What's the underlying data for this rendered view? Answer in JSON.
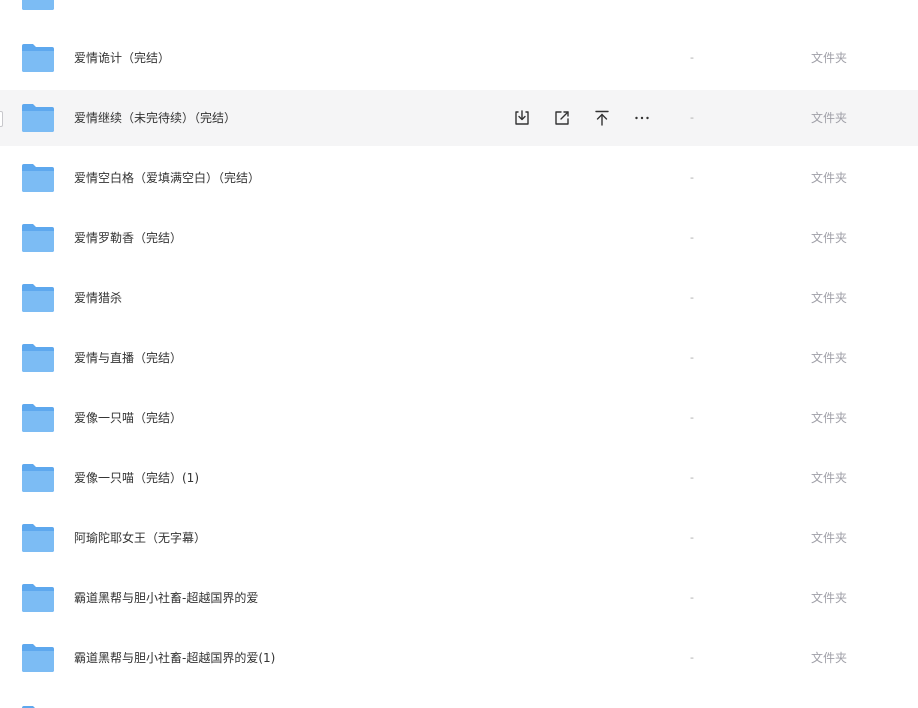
{
  "partial_top": {
    "text": "."
  },
  "hover_actions": {
    "download_icon": "download-icon",
    "share_icon": "share-icon",
    "pin_top_icon": "pin-to-top-icon",
    "more_icon": "more-icon"
  },
  "rows": [
    {
      "name": "爱情诡计（完结）",
      "size": "-",
      "type": "文件夹"
    },
    {
      "name": "爱情继续（未完待续）（完结）",
      "size": "-",
      "type": "文件夹"
    },
    {
      "name": "爱情空白格（爱填满空白）（完结）",
      "size": "-",
      "type": "文件夹"
    },
    {
      "name": "爱情罗勒香（完结）",
      "size": "-",
      "type": "文件夹"
    },
    {
      "name": "爱情猎杀",
      "size": "-",
      "type": "文件夹"
    },
    {
      "name": "爱情与直播（完结）",
      "size": "-",
      "type": "文件夹"
    },
    {
      "name": "爱像一只喵（完结）",
      "size": "-",
      "type": "文件夹"
    },
    {
      "name": "爱像一只喵（完结）(1)",
      "size": "-",
      "type": "文件夹"
    },
    {
      "name": "阿瑜陀耶女王（无字幕）",
      "size": "-",
      "type": "文件夹"
    },
    {
      "name": "霸道黑帮与胆小社畜-超越国界的爱",
      "size": "-",
      "type": "文件夹"
    },
    {
      "name": "霸道黑帮与胆小社畜-超越国界的爱(1)",
      "size": "-",
      "type": "文件夹"
    }
  ],
  "colors": {
    "folder_back": "#5ea8ee",
    "folder_front": "#7cbcf4",
    "hover_bg": "#f5f5f6"
  }
}
